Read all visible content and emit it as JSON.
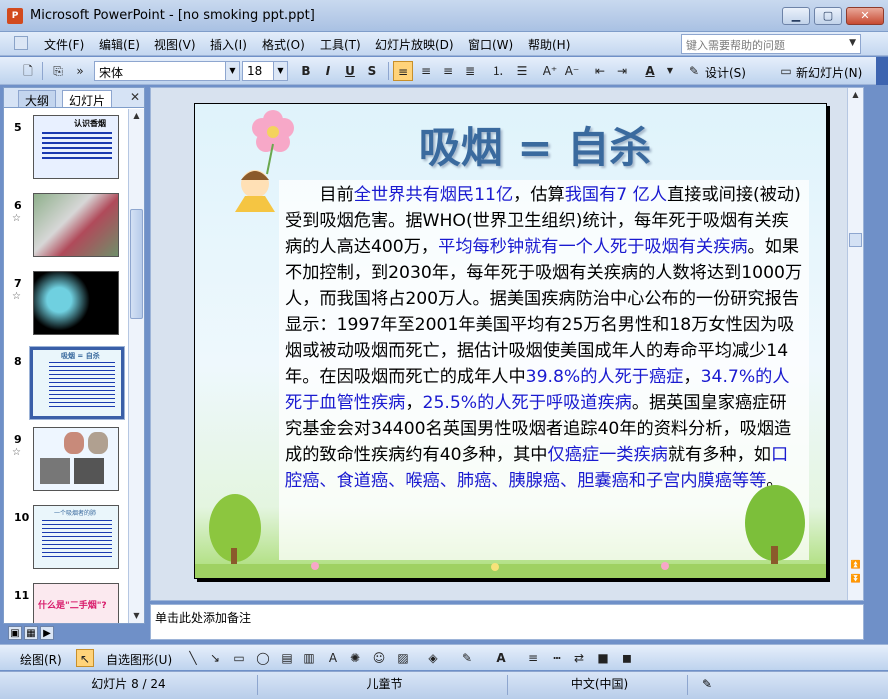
{
  "window": {
    "title": "Microsoft PowerPoint - [no smoking ppt.ppt]",
    "icon": "powerpoint-icon"
  },
  "menu": {
    "items": [
      "文件(F)",
      "编辑(E)",
      "视图(V)",
      "插入(I)",
      "格式(O)",
      "工具(T)",
      "幻灯片放映(D)",
      "窗口(W)",
      "帮助(H)"
    ],
    "help_placeholder": "键入需要帮助的问题"
  },
  "toolbar": {
    "font": "宋体",
    "size": "18",
    "bold": "B",
    "italic": "I",
    "underline": "U",
    "shadow": "S",
    "design_label": "设计(S)",
    "new_slide_label": "新幻灯片(N)"
  },
  "panel": {
    "tabs": [
      "大纲",
      "幻灯片"
    ],
    "slides": [
      {
        "num": "5",
        "title": "认识香烟",
        "star": ""
      },
      {
        "num": "6",
        "title": "",
        "star": "☆"
      },
      {
        "num": "7",
        "title": "",
        "star": "☆"
      },
      {
        "num": "8",
        "title": "吸烟 = 自杀",
        "star": ""
      },
      {
        "num": "9",
        "title": "",
        "star": "☆"
      },
      {
        "num": "10",
        "title": "一个吸烟者的肺",
        "star": ""
      },
      {
        "num": "11",
        "title": "什么是\"二手烟\"?",
        "star": ""
      }
    ]
  },
  "slide": {
    "title": "吸烟 = 自杀",
    "body": [
      {
        "t": "　　目前",
        "h": false
      },
      {
        "t": "全世界共有烟民11亿",
        "h": true
      },
      {
        "t": "，估算",
        "h": false
      },
      {
        "t": "我国有7 亿人",
        "h": true
      },
      {
        "t": "直接或间接(被动)受到吸烟危害。据WHO(世界卫生组织)统计，每年死于吸烟有关疾病的人高达400万，",
        "h": false
      },
      {
        "t": "平均每秒钟就有一个人死于吸烟有关疾病",
        "h": true
      },
      {
        "t": "。如果不加控制，到2030年，每年死于吸烟有关疾病的人数将达到1000万人，而我国将占200万人。据美国疾病防治中心公布的一份研究报告显示：1997年至2001年美国平均有25万名男性和18万女性因为吸烟或被动吸烟而死亡，据估计吸烟使美国成年人的寿命平均减少14年。在因吸烟而死亡的成年人中",
        "h": false
      },
      {
        "t": "39.8%的人死于癌症",
        "h": true
      },
      {
        "t": "，",
        "h": false
      },
      {
        "t": "34.7%的人死于血管性疾病",
        "h": true
      },
      {
        "t": "，",
        "h": false
      },
      {
        "t": "25.5%的人死于呼吸道疾病",
        "h": true
      },
      {
        "t": "。据英国皇家癌症研究基金会对34400名英国男性吸烟者追踪40年的资料分析，吸烟造成的致命性疾病约有40多种，其中",
        "h": false
      },
      {
        "t": "仅癌症一类疾病",
        "h": true
      },
      {
        "t": "就有多种，如",
        "h": false
      },
      {
        "t": "口腔癌、食道癌、喉癌、肺癌、胰腺癌、胆囊癌和子宫内膜癌等等",
        "h": true
      },
      {
        "t": "。",
        "h": false
      }
    ]
  },
  "notes": {
    "placeholder": "单击此处添加备注"
  },
  "drawbar": {
    "draw_label": "绘图(R)",
    "autoshape_label": "自选图形(U)"
  },
  "status": {
    "slide": "幻灯片 8 / 24",
    "design": "儿童节",
    "language": "中文(中国)"
  },
  "colors": {
    "accent": "#3a6a9e",
    "highlight": "#1a1ad0"
  }
}
